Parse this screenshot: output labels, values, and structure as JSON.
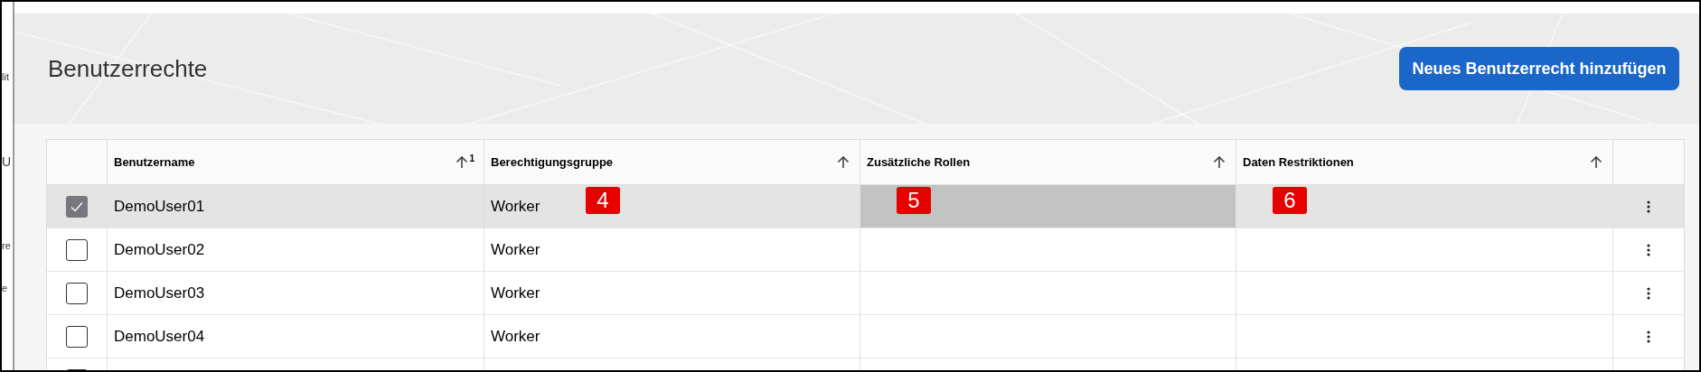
{
  "background_window": {
    "fragments": [
      "lit",
      "U",
      "re",
      "e"
    ]
  },
  "header": {
    "title": "Benutzerrechte",
    "add_button": "Neues Benutzerrecht hinzufügen"
  },
  "table": {
    "columns": [
      {
        "label": "Benutzername",
        "sort_order": "1"
      },
      {
        "label": "Berechtigungsgruppe"
      },
      {
        "label": "Zusätzliche Rollen"
      },
      {
        "label": "Daten Restriktionen"
      }
    ],
    "rows": [
      {
        "selected": true,
        "name": "DemoUser01",
        "group": "Worker",
        "roles_highlighted": true,
        "group_badge": "4",
        "roles_badge": "5",
        "restrictions_badge": "6"
      },
      {
        "selected": false,
        "name": "DemoUser02",
        "group": "Worker"
      },
      {
        "selected": false,
        "name": "DemoUser03",
        "group": "Worker"
      },
      {
        "selected": false,
        "name": "DemoUser04",
        "group": "Worker"
      },
      {
        "selected": false
      }
    ]
  }
}
